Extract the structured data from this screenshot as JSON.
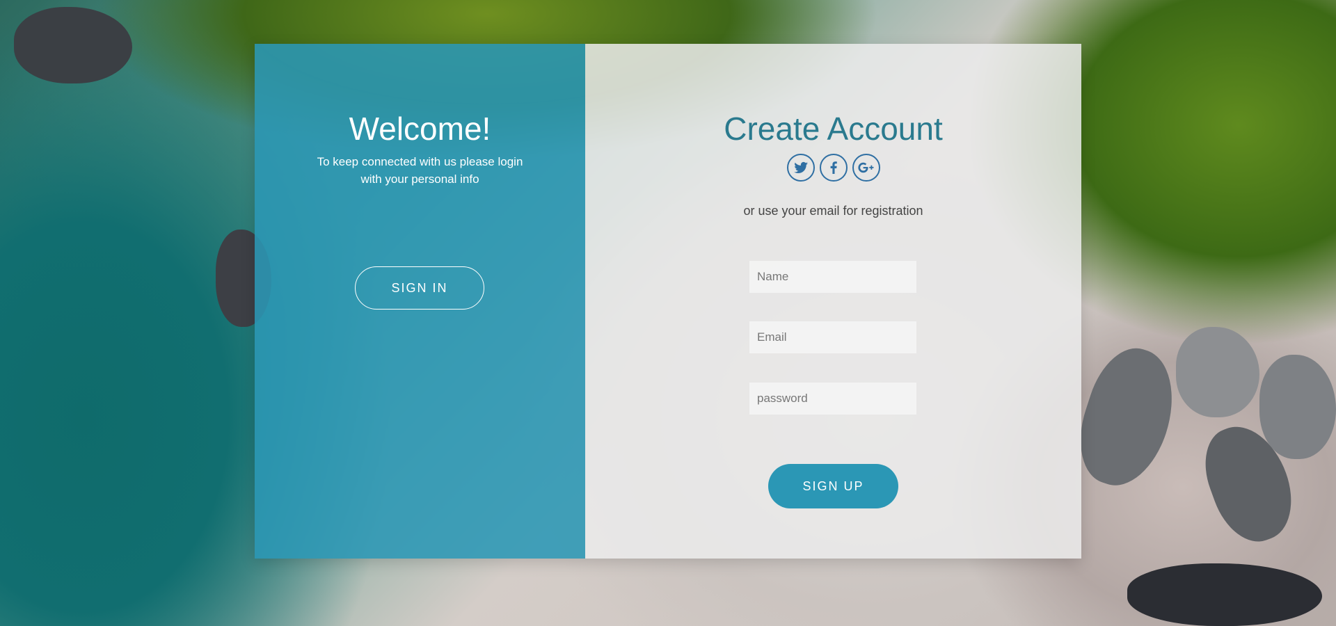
{
  "welcome": {
    "title": "Welcome!",
    "text": "To keep connected with us please login with your personal info",
    "signin_label": "SIGN IN"
  },
  "register": {
    "title": "Create Account",
    "social": [
      {
        "icon": "twitter-icon",
        "glyph": "t"
      },
      {
        "icon": "facebook-icon",
        "glyph": "f"
      },
      {
        "icon": "google-plus-icon",
        "glyph": "G+"
      }
    ],
    "or_text": "or use your email for registration",
    "name_placeholder": "Name",
    "email_placeholder": "Email",
    "password_placeholder": "password",
    "signup_label": "SIGN UP"
  },
  "colors": {
    "accent": "#2b97b5",
    "title_teal": "#2a7a8e",
    "social_blue": "#2f6fa3"
  }
}
